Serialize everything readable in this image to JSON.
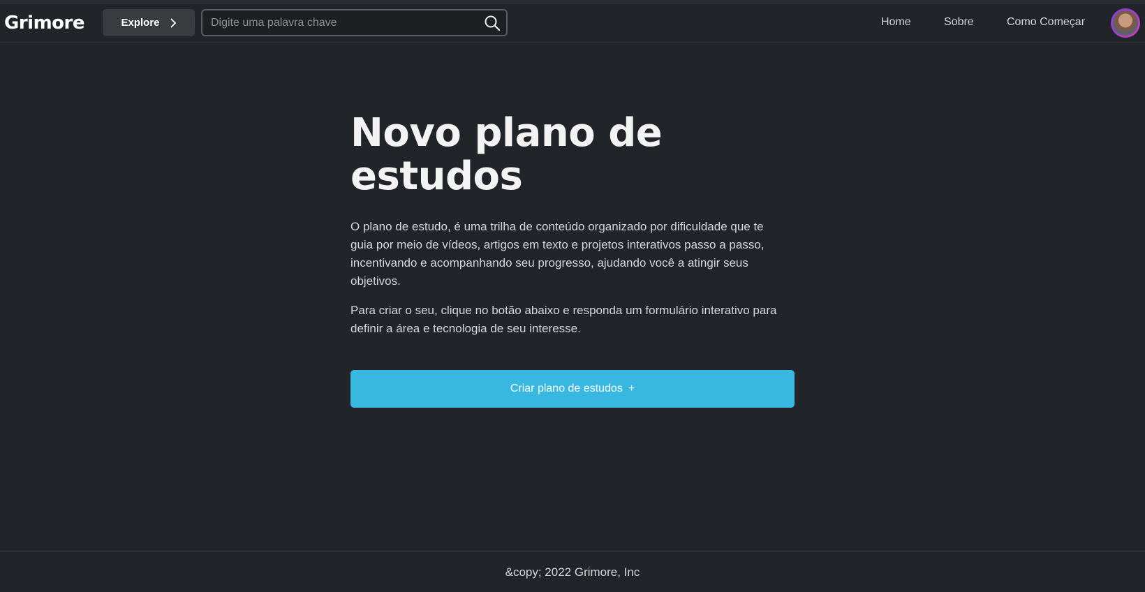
{
  "header": {
    "logo": "Grimore",
    "explore_label": "Explore",
    "search_placeholder": "Digite uma palavra chave",
    "nav": [
      {
        "label": "Home"
      },
      {
        "label": "Sobre"
      },
      {
        "label": "Como Começar"
      }
    ],
    "icons": {
      "explore": "chevron-right-icon",
      "search": "search-icon",
      "avatar": "avatar"
    }
  },
  "main": {
    "title": "Novo plano de estudos",
    "paragraph_1": "O plano de estudo, é uma trilha de conteúdo organizado por dificuldade que te guia por meio de vídeos, artigos em texto e projetos interativos passo a passo, incentivando e acompanhando seu progresso, ajudando você a atingir seus objetivos.",
    "paragraph_2": "Para criar o seu, clique no botão abaixo e responda um formulário interativo para definir a área e tecnologia de seu interesse.",
    "cta_label": "Criar plano de estudos",
    "cta_icon": "+"
  },
  "footer": {
    "text": "&copy; 2022 Grimore, Inc"
  },
  "colors": {
    "background": "#212429",
    "accent": "#38b8e0",
    "explore_bg": "#3a3b3e"
  }
}
